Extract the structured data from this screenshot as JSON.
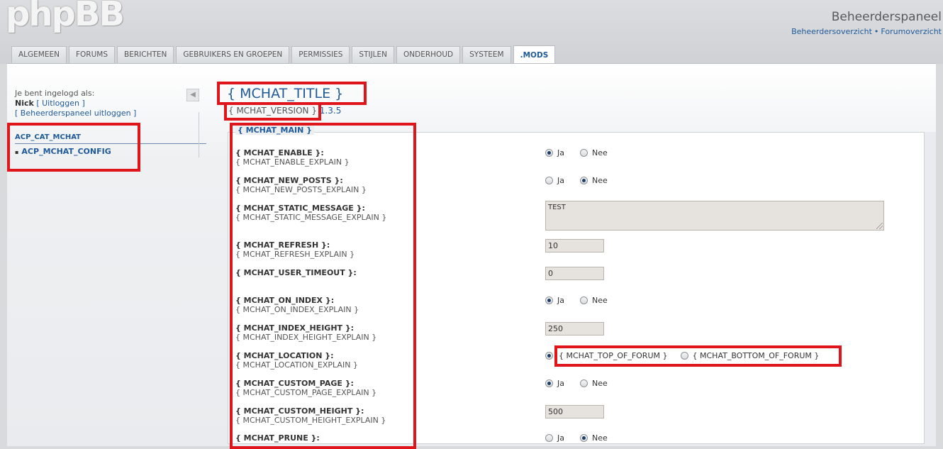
{
  "header": {
    "logo": "phpBB",
    "panel_title": "Beheerderspaneel",
    "link_overview": "Beheerdersoverzicht",
    "link_separator": "•",
    "link_forum": "Forumoverzicht"
  },
  "tabs": [
    {
      "label": "ALGEMEEN"
    },
    {
      "label": "FORUMS"
    },
    {
      "label": "BERICHTEN"
    },
    {
      "label": "GEBRUIKERS EN GROEPEN"
    },
    {
      "label": "PERMISSIES"
    },
    {
      "label": "STIJLEN"
    },
    {
      "label": "ONDERHOUD"
    },
    {
      "label": "SYSTEEM"
    },
    {
      "label": ".MODS"
    }
  ],
  "sidebar": {
    "logged_in_as": "Je bent ingelogd als:",
    "username": "Nick",
    "logout": "[ Uitloggen ]",
    "admin_logout": "[ Beheerderspaneel uitloggen ]",
    "category": "ACP_CAT_MCHAT",
    "item": "ACP_MCHAT_CONFIG",
    "collapse_icon": "◀"
  },
  "main": {
    "title": "{ MCHAT_TITLE }",
    "version_label": "{ MCHAT_VERSION }",
    "version_number": "1.3.5",
    "legend": "{ MCHAT_MAIN }",
    "rows": [
      {
        "title": "{ MCHAT_ENABLE }:",
        "explain": "{ MCHAT_ENABLE_EXPLAIN }"
      },
      {
        "title": "{ MCHAT_NEW_POSTS }:",
        "explain": "{ MCHAT_NEW_POSTS_EXPLAIN }"
      },
      {
        "title": "{ MCHAT_STATIC_MESSAGE }:",
        "explain": "{ MCHAT_STATIC_MESSAGE_EXPLAIN }"
      },
      {
        "title": "{ MCHAT_REFRESH }:",
        "explain": "{ MCHAT_REFRESH_EXPLAIN }"
      },
      {
        "title": "{ MCHAT_USER_TIMEOUT }:",
        "explain": ""
      },
      {
        "title": "{ MCHAT_ON_INDEX }:",
        "explain": "{ MCHAT_ON_INDEX_EXPLAIN }"
      },
      {
        "title": "{ MCHAT_INDEX_HEIGHT }:",
        "explain": "{ MCHAT_INDEX_HEIGHT_EXPLAIN }"
      },
      {
        "title": "{ MCHAT_LOCATION }:",
        "explain": "{ MCHAT_LOCATION_EXPLAIN }"
      },
      {
        "title": "{ MCHAT_CUSTOM_PAGE }:",
        "explain": "{ MCHAT_CUSTOM_PAGE_EXPLAIN }"
      },
      {
        "title": "{ MCHAT_CUSTOM_HEIGHT }:",
        "explain": "{ MCHAT_CUSTOM_HEIGHT_EXPLAIN }"
      },
      {
        "title": "{ MCHAT_PRUNE }:",
        "explain": ""
      }
    ],
    "yes": "Ja",
    "no": "Nee",
    "values": {
      "static_message": "TEST",
      "refresh": "10",
      "user_timeout": "0",
      "index_height": "250",
      "custom_height": "500"
    },
    "location_top": "{ MCHAT_TOP_OF_FORUM }",
    "location_bottom": "{ MCHAT_BOTTOM_OF_FORUM }"
  },
  "colors": {
    "accent": "#1f5a9a",
    "highlight": "#e0151c"
  }
}
